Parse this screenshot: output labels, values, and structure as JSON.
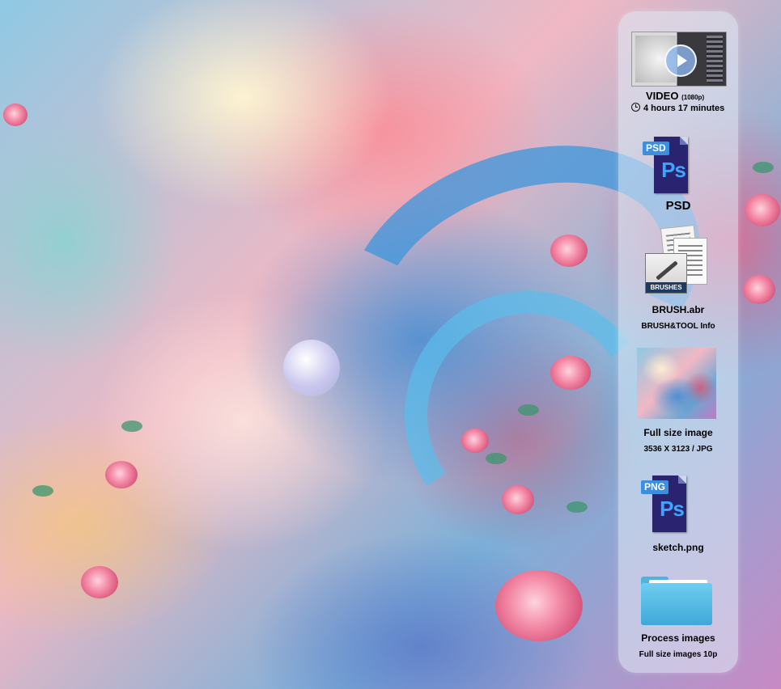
{
  "sidebar": {
    "video": {
      "title": "VIDEO",
      "resolution": "(1080p)",
      "duration": "4 hours 17 minutes",
      "icon": "play-icon"
    },
    "psd": {
      "icon_tab": "PSD",
      "icon_mark": "Ps",
      "label": "PSD"
    },
    "brush": {
      "box_label": "BRUSHES",
      "label": "BRUSH.abr",
      "sublabel": "BRUSH&TOOL Info"
    },
    "full_image": {
      "label": "Full size image",
      "sublabel": "3536 X 3123 / JPG"
    },
    "sketch": {
      "icon_tab": "PNG",
      "icon_mark": "Ps",
      "label": "sketch.png"
    },
    "process": {
      "icon": "folder-icon",
      "label": "Process images",
      "sublabel": "Full size images 10p"
    }
  },
  "colors": {
    "ps_dark": "#2a2470",
    "ps_blue": "#3ea5ff",
    "folder_blue": "#4fb3dd"
  }
}
